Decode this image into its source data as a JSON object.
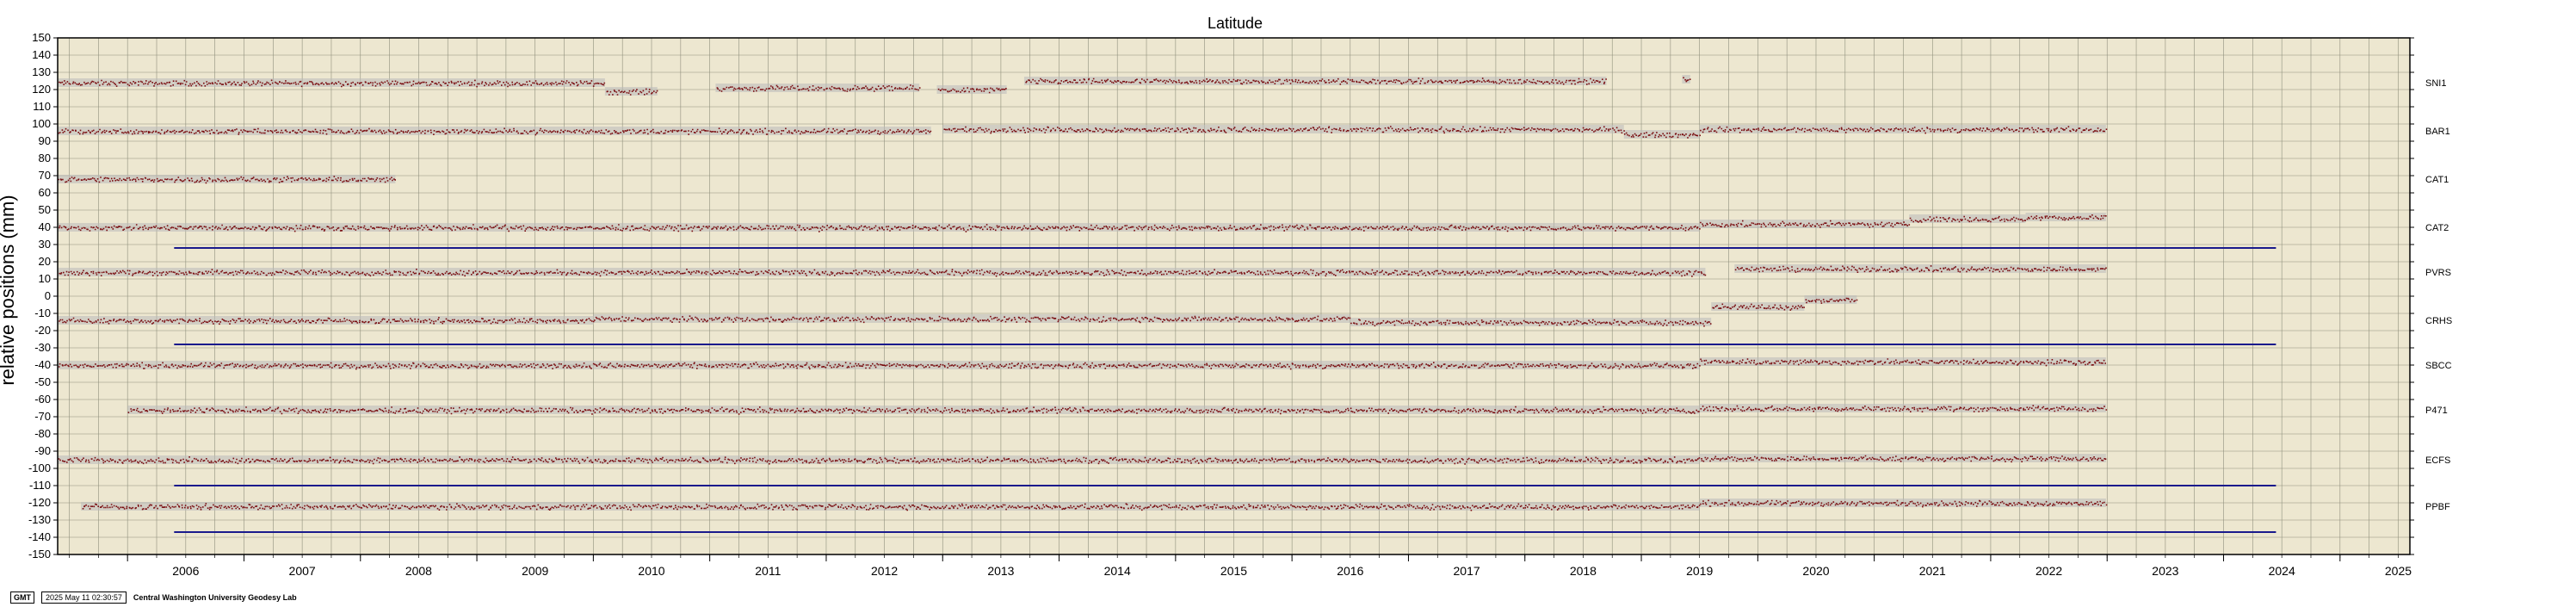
{
  "chart_data": {
    "type": "scatter",
    "title": "Latitude",
    "ylabel": "relative positions (mm)",
    "xlabel": "",
    "xlim": [
      2005.4,
      2025.6
    ],
    "ylim": [
      -150,
      150
    ],
    "x_ticks": [
      "2006",
      "2007",
      "2008",
      "2009",
      "2010",
      "2011",
      "2012",
      "2013",
      "2014",
      "2015",
      "2016",
      "2017",
      "2018",
      "2019",
      "2020",
      "2021",
      "2022",
      "2023",
      "2024",
      "2025"
    ],
    "y_ticks": [
      150,
      140,
      130,
      120,
      110,
      100,
      90,
      80,
      70,
      60,
      50,
      40,
      30,
      20,
      10,
      0,
      -10,
      -20,
      -30,
      -40,
      -50,
      -60,
      -70,
      -80,
      -90,
      -100,
      -110,
      -120,
      -130,
      -140,
      -150
    ],
    "grid": true,
    "background": "#ede7d0",
    "point_color": "#7a0d10",
    "error_color": "#b9b9b9",
    "reference_line_color": "#1a1a8c",
    "series": [
      {
        "name": "SNI1",
        "segments": [
          [
            2005.4,
            2010.1,
            124
          ],
          [
            2010.1,
            2010.55,
            119
          ],
          [
            2011.05,
            2012.8,
            121
          ],
          [
            2012.95,
            2013.55,
            120
          ],
          [
            2013.7,
            2018.7,
            125
          ],
          [
            2019.35,
            2019.42,
            126
          ]
        ]
      },
      {
        "name": "BAR1",
        "segments": [
          [
            2005.4,
            2012.9,
            96
          ],
          [
            2013.0,
            2018.85,
            97
          ],
          [
            2018.85,
            2019.5,
            94
          ],
          [
            2019.5,
            2022.99,
            97
          ]
        ]
      },
      {
        "name": "CAT1",
        "segments": [
          [
            2005.4,
            2008.3,
            68
          ]
        ]
      },
      {
        "name": "CAT2",
        "segments": [
          [
            2005.4,
            2019.5,
            40
          ],
          [
            2019.5,
            2021.3,
            42
          ],
          [
            2021.3,
            2022.3,
            45
          ],
          [
            2022.3,
            2022.99,
            46
          ]
        ]
      },
      {
        "name": "PVRS",
        "segments": [
          [
            2005.4,
            2019.55,
            14
          ],
          [
            2019.8,
            2022.99,
            16
          ]
        ]
      },
      {
        "name": "CRHS",
        "segments": [
          [
            2005.4,
            2010.0,
            -14
          ],
          [
            2010.0,
            2016.5,
            -13
          ],
          [
            2016.5,
            2019.6,
            -15
          ],
          [
            2019.6,
            2020.4,
            -6
          ],
          [
            2020.4,
            2020.85,
            -2
          ]
        ]
      },
      {
        "name": "SBCC",
        "segments": [
          [
            2005.4,
            2019.5,
            -40
          ],
          [
            2019.5,
            2022.99,
            -38
          ]
        ]
      },
      {
        "name": "P471",
        "segments": [
          [
            2006.0,
            2019.5,
            -66
          ],
          [
            2019.5,
            2022.99,
            -65
          ]
        ]
      },
      {
        "name": "ECFS",
        "segments": [
          [
            2005.4,
            2019.5,
            -95
          ],
          [
            2019.5,
            2022.99,
            -94
          ]
        ]
      },
      {
        "name": "PPBF",
        "segments": [
          [
            2005.6,
            2019.5,
            -122
          ],
          [
            2019.5,
            2022.99,
            -120
          ]
        ]
      }
    ],
    "reference_lines": [
      {
        "x_start": 2006.4,
        "x_end": 2024.45,
        "y": 28
      },
      {
        "x_start": 2006.4,
        "x_end": 2024.45,
        "y": -28
      },
      {
        "x_start": 2006.4,
        "x_end": 2024.45,
        "y": -110
      },
      {
        "x_start": 2006.4,
        "x_end": 2024.45,
        "y": -137
      }
    ]
  },
  "footer": {
    "logo": "GMT",
    "timestamp": "2025 May 11 02:30:57",
    "lab": "Central Washington University Geodesy Lab"
  }
}
